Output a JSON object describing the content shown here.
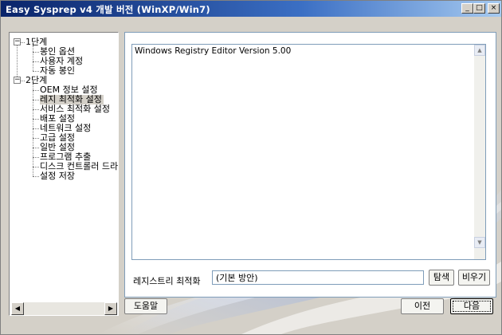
{
  "window": {
    "title": "Easy Sysprep v4 개발 버전 (WinXP/Win7)",
    "controls": {
      "minimize": "_",
      "maximize": "□",
      "close": "×"
    }
  },
  "tree": {
    "items": [
      {
        "label": "1단계",
        "level": 0,
        "expander": "−"
      },
      {
        "label": "봉인 옵션",
        "level": 1
      },
      {
        "label": "사용자 계정",
        "level": 1
      },
      {
        "label": "자동 봉인",
        "level": 1
      },
      {
        "label": "2단계",
        "level": 0,
        "expander": "−"
      },
      {
        "label": "OEM 정보 설정",
        "level": 1
      },
      {
        "label": "레지 최적화 설정",
        "level": 1,
        "selected": true
      },
      {
        "label": "서비스 최적화 설정",
        "level": 1
      },
      {
        "label": "배포 설정",
        "level": 1
      },
      {
        "label": "네트워크 설정",
        "level": 1
      },
      {
        "label": "고급 설정",
        "level": 1
      },
      {
        "label": "일반 설정",
        "level": 1
      },
      {
        "label": "프로그램 추출",
        "level": 1
      },
      {
        "label": "디스크 컨트롤러 드라",
        "level": 1
      },
      {
        "label": "설정 저장",
        "level": 1
      }
    ]
  },
  "registry": {
    "content": "Windows Registry Editor Version 5.00",
    "label": "레지스트리 최적화",
    "value": "(기본 방안)",
    "browse_label": "탐색",
    "clear_label": "비우기"
  },
  "footer": {
    "help_label": "도움말",
    "back_label": "이전",
    "next_label": "다음"
  },
  "colors": {
    "titlebar_start": "#0a246a",
    "titlebar_end": "#a6caf0",
    "face": "#d4d0c8",
    "field_border": "#7f9db9"
  }
}
